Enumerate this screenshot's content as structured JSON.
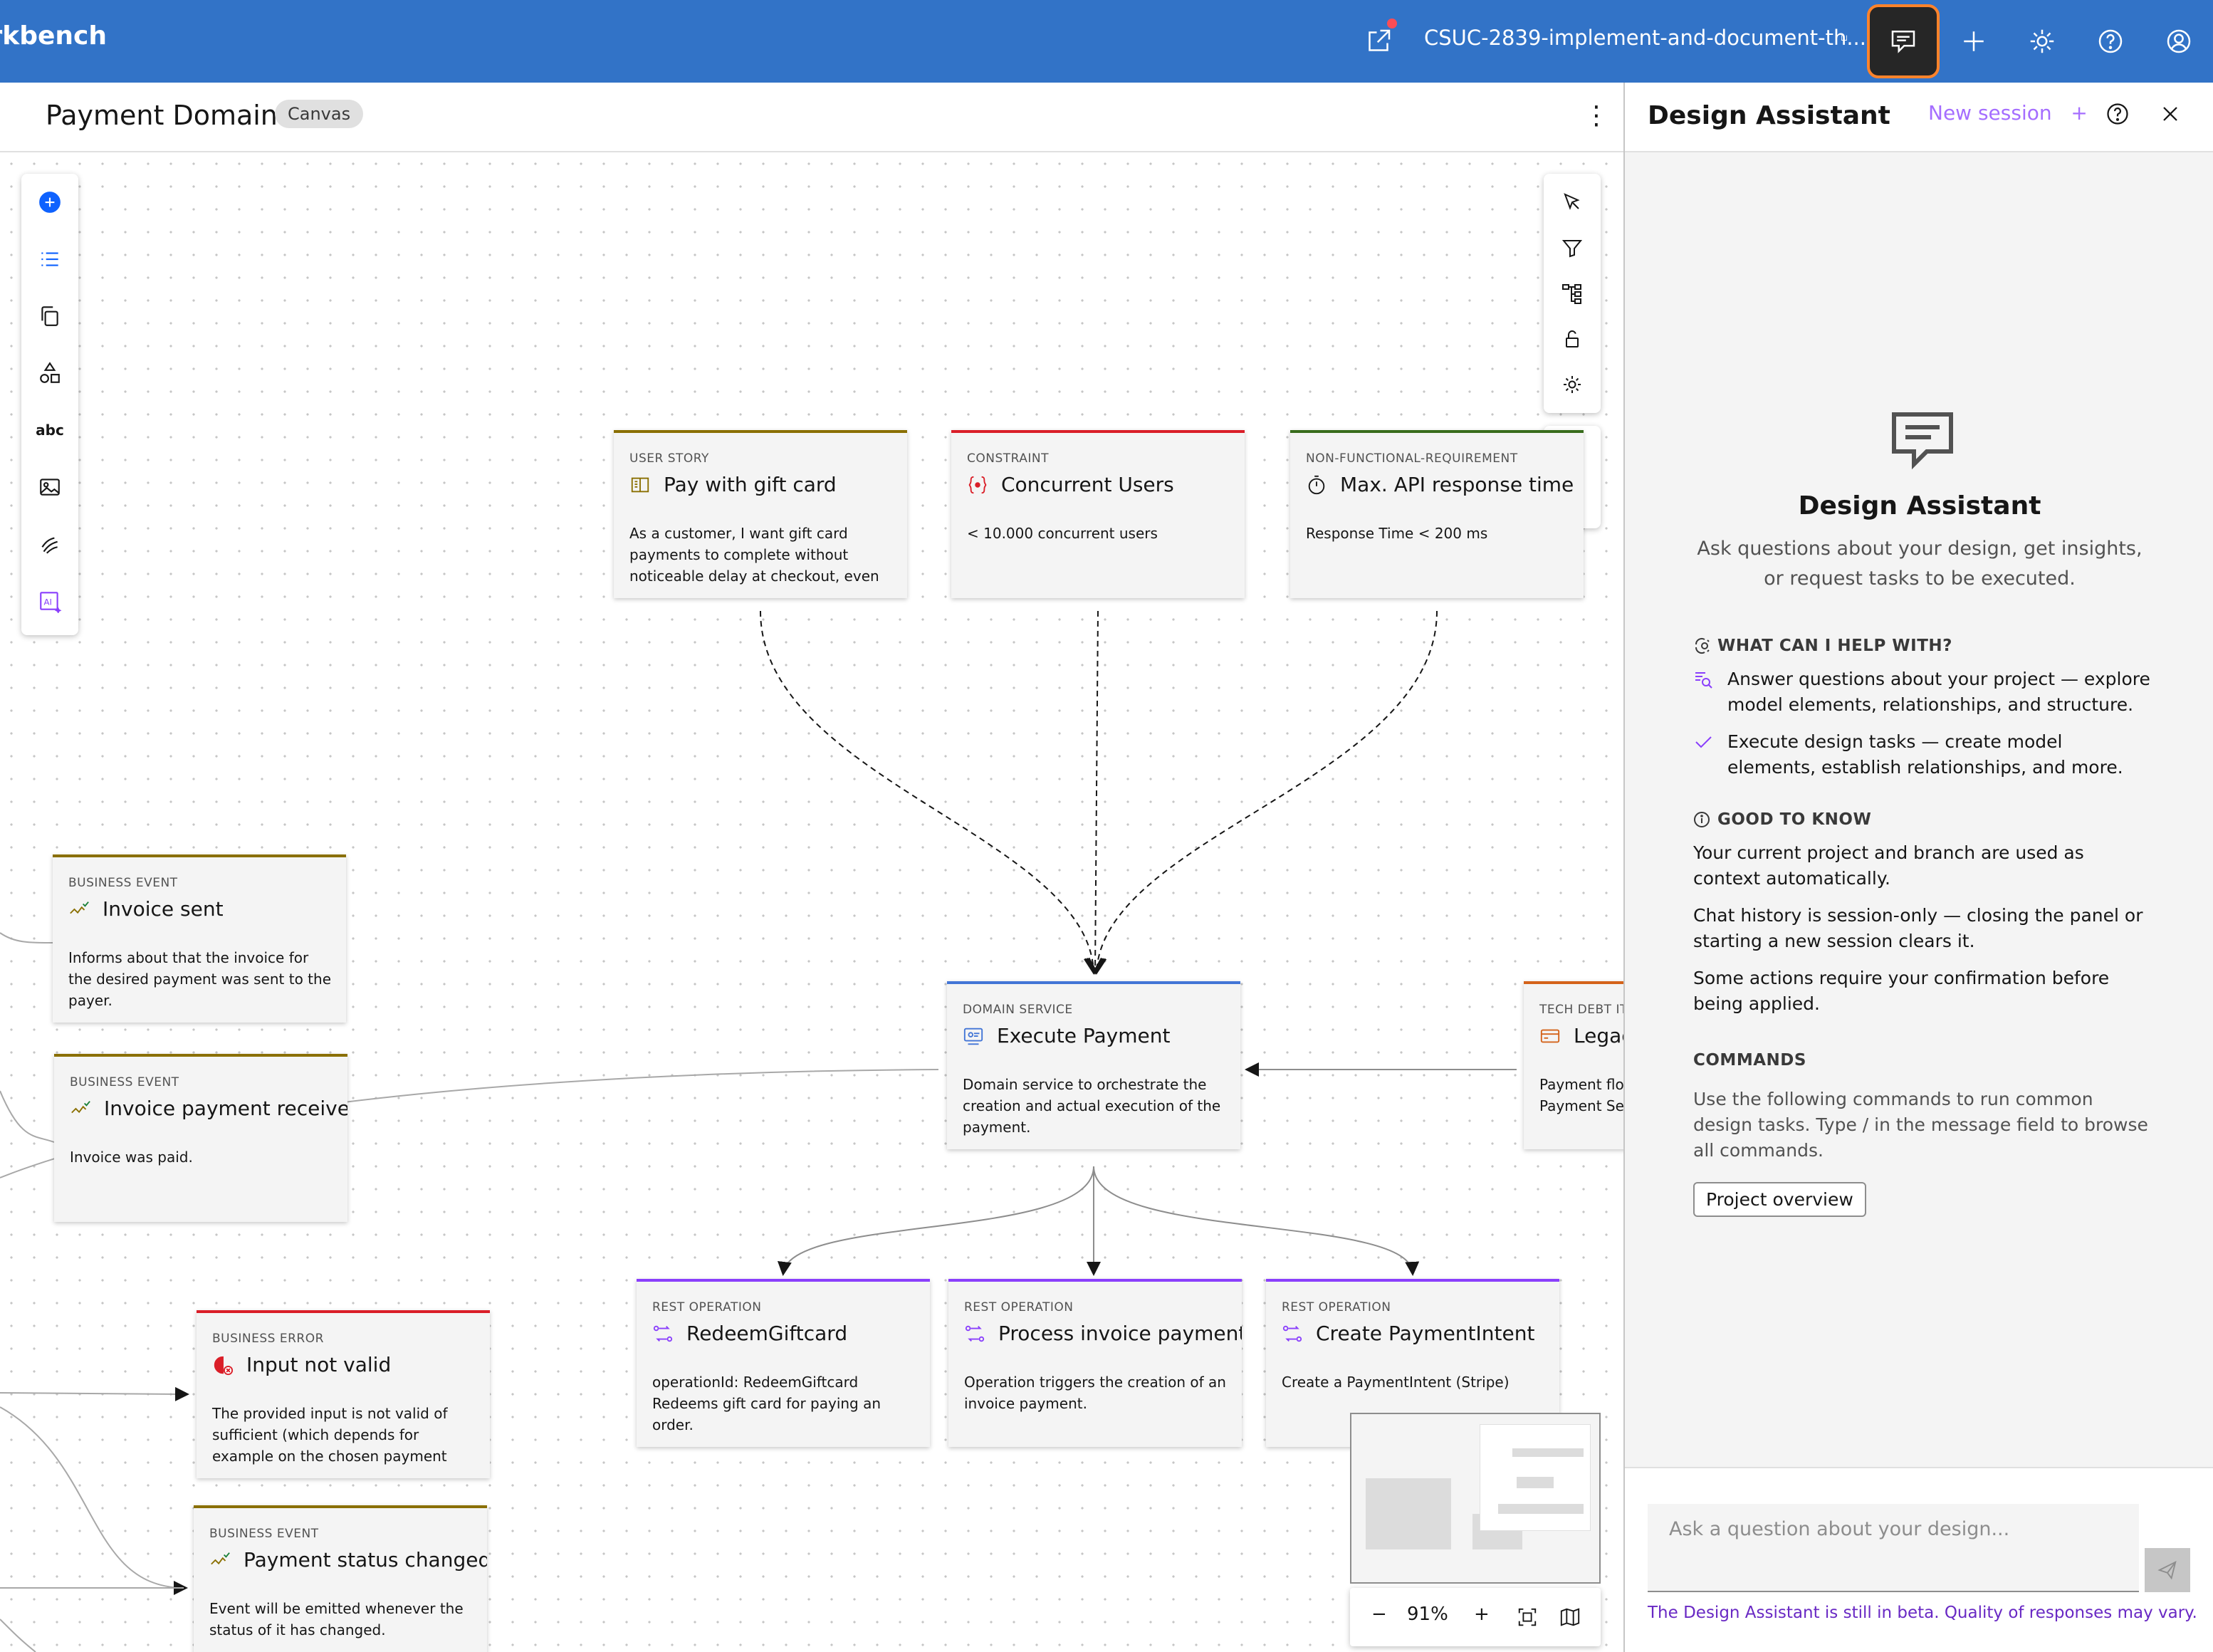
{
  "app": {
    "brand": "orkbench",
    "branch": "CSUC-2839-implement-and-document-th...",
    "branch_icon": "⑂"
  },
  "colors": {
    "topbar": "#3273c7",
    "accent_purple": "#a56eff",
    "chat_active_border": "#ff832b"
  },
  "canvas": {
    "title": "Payment Domain",
    "tag": "Canvas",
    "zoom": "91%",
    "zoom_out": "−",
    "zoom_in": "+",
    "left_toolbar_icons": [
      "add-element-icon",
      "list-icon",
      "copy-icon",
      "shapes-icon",
      "text-icon",
      "image-icon",
      "connector-icon",
      "ai-icon"
    ],
    "text_tool_label": "abc",
    "ai_tool_label": "AI",
    "right_toolbar_icons": [
      "select-pointer-icon",
      "filter-icon",
      "tree-icon",
      "lock-icon",
      "settings-icon",
      "undo-icon",
      "redo-icon"
    ]
  },
  "cards": [
    {
      "type": "USER STORY",
      "title": "Pay with gift card",
      "desc": "As a customer, I want gift card payments to complete without noticeable delay at checkout, even",
      "icon": "book-icon",
      "color": "#8a6f00"
    },
    {
      "type": "CONSTRAINT",
      "title": "Concurrent Users",
      "desc": "< 10.000 concurrent users",
      "icon": "constraint-icon",
      "color": "#da1e28"
    },
    {
      "type": "NON-FUNCTIONAL-REQUIREMENT",
      "title": "Max. API response time",
      "desc": "Response Time < 200 ms",
      "icon": "timer-icon",
      "color": "#386c1c"
    },
    {
      "type": "BUSINESS EVENT",
      "title": "Invoice sent",
      "desc": "Informs about that the invoice for the desired payment was sent to the payer.",
      "icon": "event-icon",
      "color": "#8a6f00"
    },
    {
      "type": "BUSINESS EVENT",
      "title": "Invoice payment received",
      "desc": "Invoice was paid.",
      "icon": "event-icon",
      "color": "#8a6f00"
    },
    {
      "type": "DOMAIN SERVICE",
      "title": "Execute Payment",
      "desc": "Domain service to orchestrate the creation and actual execution of the payment.",
      "icon": "service-icon",
      "color": "#4275d6"
    },
    {
      "type": "TECH DEBT ITEM",
      "title": "Legacy",
      "desc": "Payment flow logic implemented in Payment Service",
      "icon": "debt-icon",
      "color": "#d4631a"
    },
    {
      "type": "BUSINESS ERROR",
      "title": "Input not valid",
      "desc": "The provided input is not valid of sufficient (which depends for example on the chosen payment",
      "icon": "error-icon",
      "color": "#da1e28"
    },
    {
      "type": "REST OPERATION",
      "title": "RedeemGiftcard",
      "desc": "operationId: RedeemGiftcard Redeems gift card for paying an order.",
      "icon": "rest-icon",
      "color": "#8a3ffc"
    },
    {
      "type": "REST OPERATION",
      "title": "Process invoice payment",
      "desc": "Operation triggers the creation of an invoice payment.",
      "icon": "rest-icon",
      "color": "#8a3ffc"
    },
    {
      "type": "REST OPERATION",
      "title": "Create PaymentIntent",
      "desc": "Create a PaymentIntent (Stripe)",
      "icon": "rest-icon",
      "color": "#8a3ffc"
    },
    {
      "type": "BUSINESS EVENT",
      "title": "Payment status changed",
      "desc": "Event will be emitted whenever the status of it has changed.",
      "icon": "event-icon",
      "color": "#8a6f00"
    }
  ],
  "assistant": {
    "title": "Design Assistant",
    "new_session": "New session",
    "new_session_plus": "+",
    "hero_title": "Design Assistant",
    "hero_sub": "Ask questions about your design, get insights, or request tasks to be executed.",
    "help_heading": "WHAT CAN I HELP WITH?",
    "help_items": [
      "Answer questions about your project — explore model elements, relationships, and structure.",
      "Execute design tasks — create model elements, establish relationships, and more."
    ],
    "know_heading": "GOOD TO KNOW",
    "know_items": [
      "Your current project and branch are used as context automatically.",
      "Chat history is session-only — closing the panel or starting a new session clears it.",
      "Some actions require your confirmation before being applied."
    ],
    "commands_heading": "COMMANDS",
    "commands_text": "Use the following commands to run common design tasks. Type / in the message field to browse all commands.",
    "command_button": "Project overview",
    "input_placeholder": "Ask a question about your design...",
    "beta_note": "The Design Assistant is still in beta. Quality of responses may vary."
  }
}
